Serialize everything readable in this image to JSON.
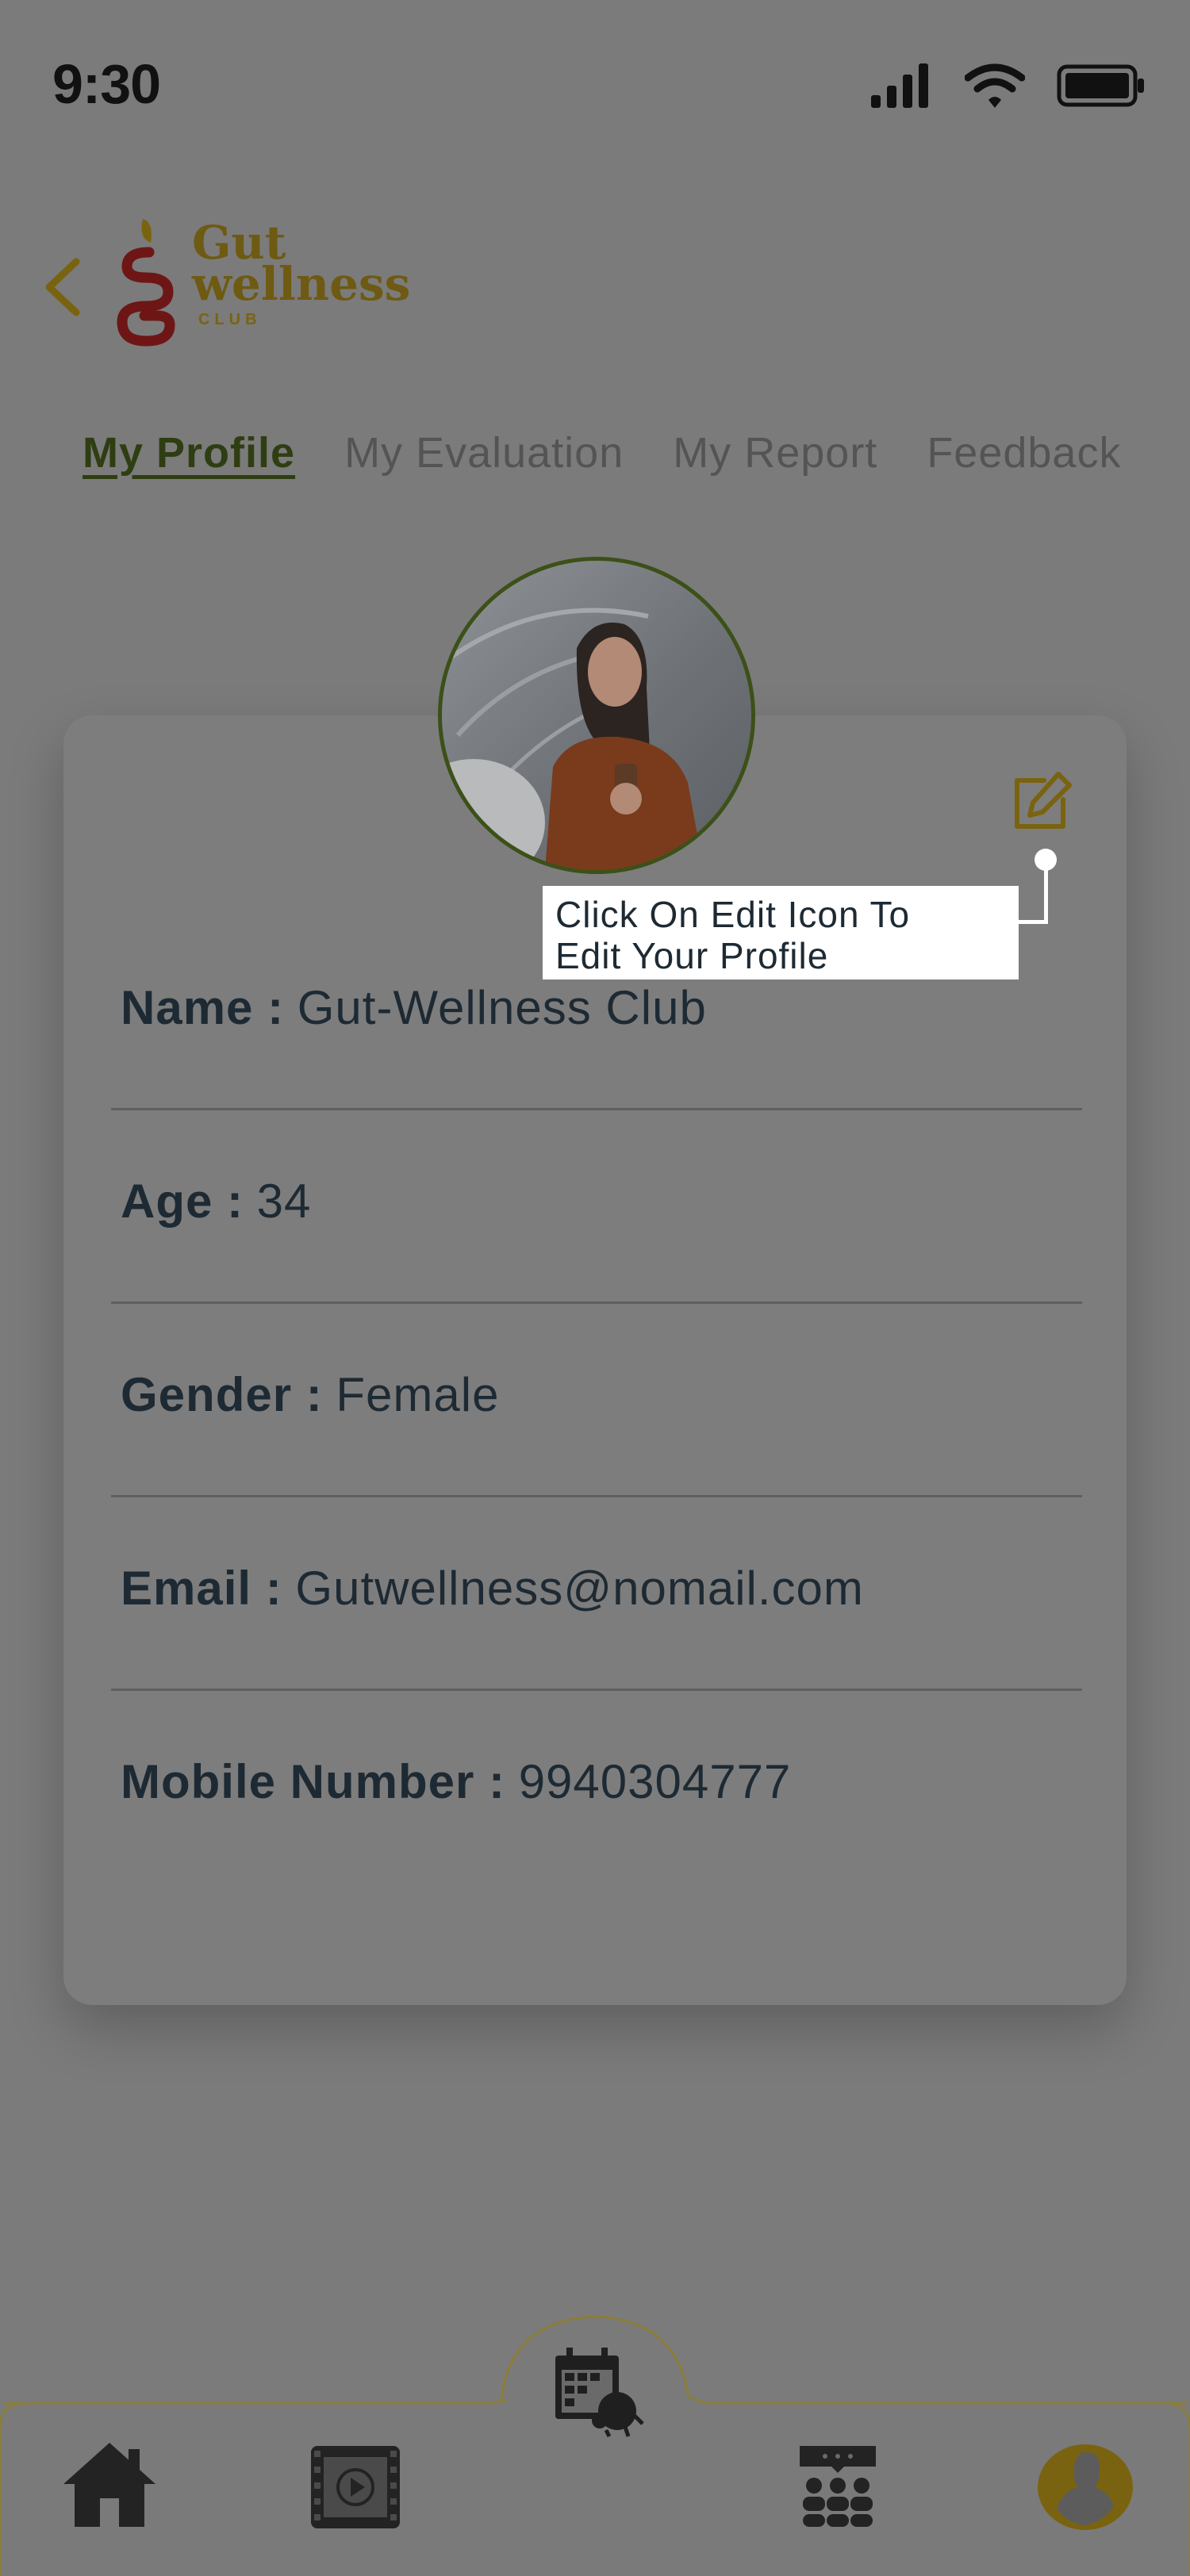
{
  "status_bar": {
    "time": "9:30"
  },
  "header": {
    "logo_line1": "Gut",
    "logo_line2": "wellness",
    "logo_line3": "CLUB"
  },
  "tabs": [
    {
      "label": "My Profile",
      "active": true
    },
    {
      "label": "My Evaluation",
      "active": false
    },
    {
      "label": "My Report",
      "active": false
    },
    {
      "label": "Feedback",
      "active": false
    }
  ],
  "tooltip": {
    "line1": "Click On Edit Icon To",
    "line2": "Edit Your Profile"
  },
  "profile": {
    "name_label": "Name :",
    "name_value": "Gut-Wellness Club",
    "age_label": "Age :",
    "age_value": "34",
    "gender_label": "Gender :",
    "gender_value": "Female",
    "email_label": "Email :",
    "email_value": "Gutwellness@nomail.com",
    "mobile_label": "Mobile Number :",
    "mobile_value": "9940304777"
  },
  "bottom_nav": [
    "home-icon",
    "video-icon",
    "calendar-icon",
    "community-icon",
    "profile-icon"
  ],
  "colors": {
    "overlay_bg": "#7b7b7b",
    "accent_gold": "#7a6310",
    "tab_active": "#2f3e12",
    "text_dark": "#1e2a33"
  }
}
